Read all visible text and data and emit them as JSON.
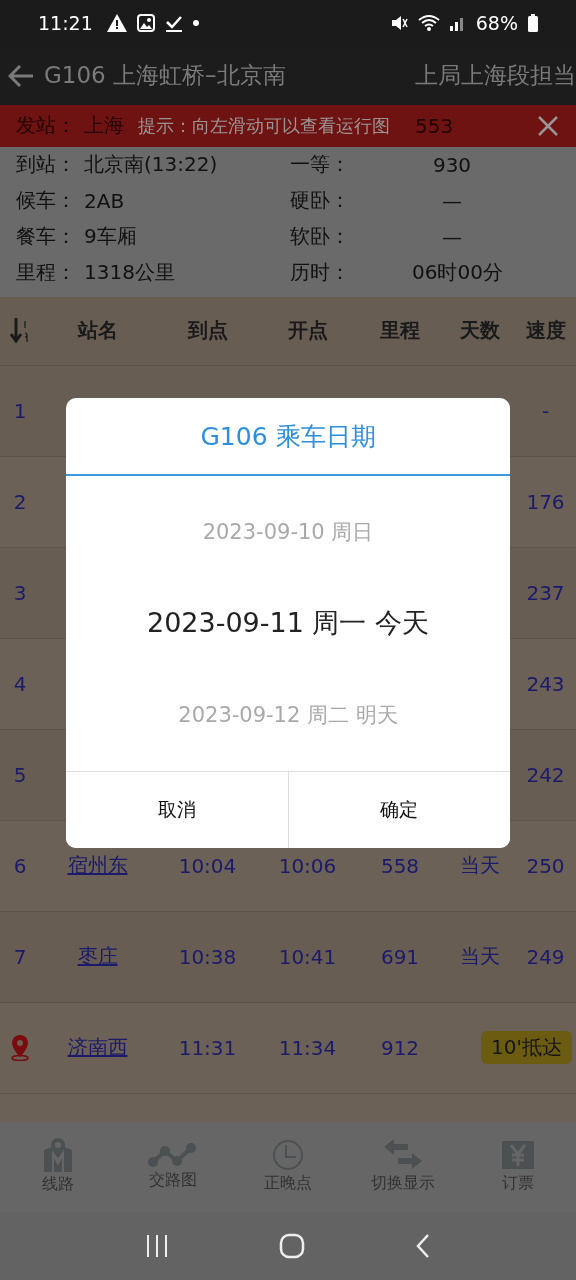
{
  "status_bar": {
    "time": "11:21",
    "battery": "68%"
  },
  "title_bar": {
    "title": "G106 上海虹桥–北京南",
    "subtitle": "上局上海段担当"
  },
  "tip": {
    "text": "提示：向左滑动可以查看运行图",
    "covered_label": "发站：",
    "covered_value": "上海",
    "covered_number": "553"
  },
  "info_rows": [
    {
      "left_label": "到站：",
      "left_value": "北京南(13:22)",
      "right_label": "一等：",
      "right_value": "930"
    },
    {
      "left_label": "候车：",
      "left_value": "2AB",
      "right_label": "硬卧：",
      "right_value": "—"
    },
    {
      "left_label": "餐车：",
      "left_value": "9车厢",
      "right_label": "软卧：",
      "right_value": "—"
    },
    {
      "left_label": "里程：",
      "left_value": "1318公里",
      "right_label": "历时：",
      "right_value": "06时00分"
    }
  ],
  "table": {
    "columns": [
      "站名",
      "到点",
      "开点",
      "里程",
      "天数",
      "速度"
    ],
    "rows": [
      {
        "kind": "stop",
        "index": "1",
        "speed": "-"
      },
      {
        "kind": "stop",
        "index": "2",
        "speed": "176"
      },
      {
        "kind": "stop",
        "index": "3",
        "speed": "237"
      },
      {
        "kind": "stop",
        "index": "4",
        "speed": "243"
      },
      {
        "kind": "stop",
        "index": "5",
        "speed": "242"
      },
      {
        "kind": "stop",
        "index": "6",
        "station": "宿州东",
        "arrive": "10:04",
        "depart": "10:06",
        "distance": "558",
        "days": "当天",
        "speed": "250"
      },
      {
        "kind": "stop",
        "index": "7",
        "station": "枣庄",
        "arrive": "10:38",
        "depart": "10:41",
        "distance": "691",
        "days": "当天",
        "speed": "249"
      },
      {
        "kind": "current",
        "station": "济南西",
        "arrive": "11:31",
        "depart": "11:34",
        "distance": "912",
        "badge": "10'抵达"
      }
    ]
  },
  "bottom_nav": [
    {
      "label": "线路"
    },
    {
      "label": "交路图"
    },
    {
      "label": "正晚点"
    },
    {
      "label": "切换显示"
    },
    {
      "label": "订票"
    }
  ],
  "dialog": {
    "title": "G106 乘车日期",
    "options": [
      {
        "text": "2023-09-10 周日",
        "selected": false
      },
      {
        "text": "2023-09-11 周一 今天",
        "selected": true
      },
      {
        "text": "2023-09-12 周二 明天",
        "selected": false
      }
    ],
    "buttons": [
      "取消",
      "确定"
    ]
  }
}
